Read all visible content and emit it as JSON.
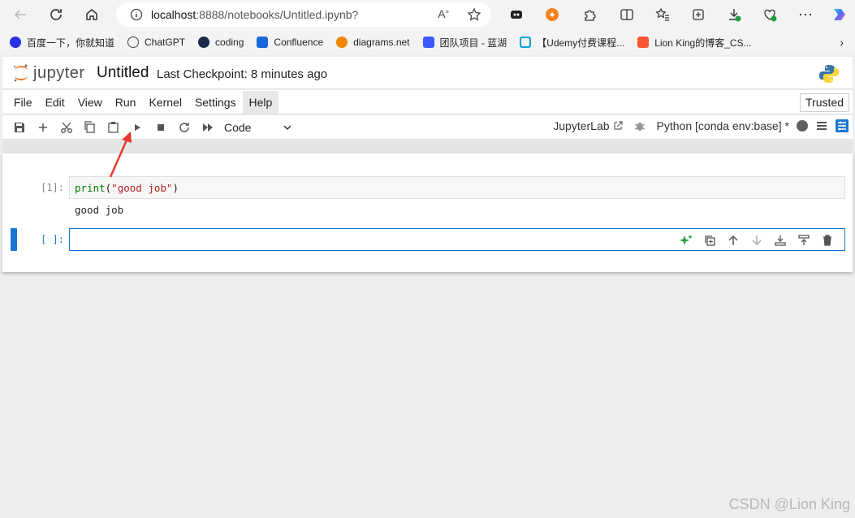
{
  "browser": {
    "url_host": "localhost",
    "url_rest": ":8888/notebooks/Untitled.ipynb?",
    "bookmarks": [
      {
        "label": "百度一下，你就知道",
        "color": "#2932e1"
      },
      {
        "label": "ChatGPT",
        "color": "#444444"
      },
      {
        "label": "coding",
        "color": "#1b2a4a"
      },
      {
        "label": "Confluence",
        "color": "#1868db"
      },
      {
        "label": "diagrams.net",
        "color": "#f08705"
      },
      {
        "label": "团队项目 - 蓝湖",
        "color": "#3d5afe"
      },
      {
        "label": "【Udemy付费课程...",
        "color": "#00a1d6"
      },
      {
        "label": "Lion King的博客_CS...",
        "color": "#fc5531"
      }
    ]
  },
  "jupyter": {
    "logo_text": "jupyter",
    "title": "Untitled",
    "checkpoint": "Last Checkpoint: 8 minutes ago",
    "menu": [
      "File",
      "Edit",
      "View",
      "Run",
      "Kernel",
      "Settings",
      "Help"
    ],
    "active_menu": "Help",
    "trusted_label": "Trusted",
    "cell_type": "Code",
    "jupyterlab_label": "JupyterLab",
    "kernel_label": "Python [conda env:base] *"
  },
  "cells": {
    "cell1_prompt": "[1]:",
    "cell1_code_fn": "print",
    "cell1_code_open": "(",
    "cell1_code_str": "\"good job\"",
    "cell1_code_close": ")",
    "cell1_output": "good job",
    "cell2_prompt": "[ ]:"
  },
  "watermark": "CSDN @Lion King"
}
